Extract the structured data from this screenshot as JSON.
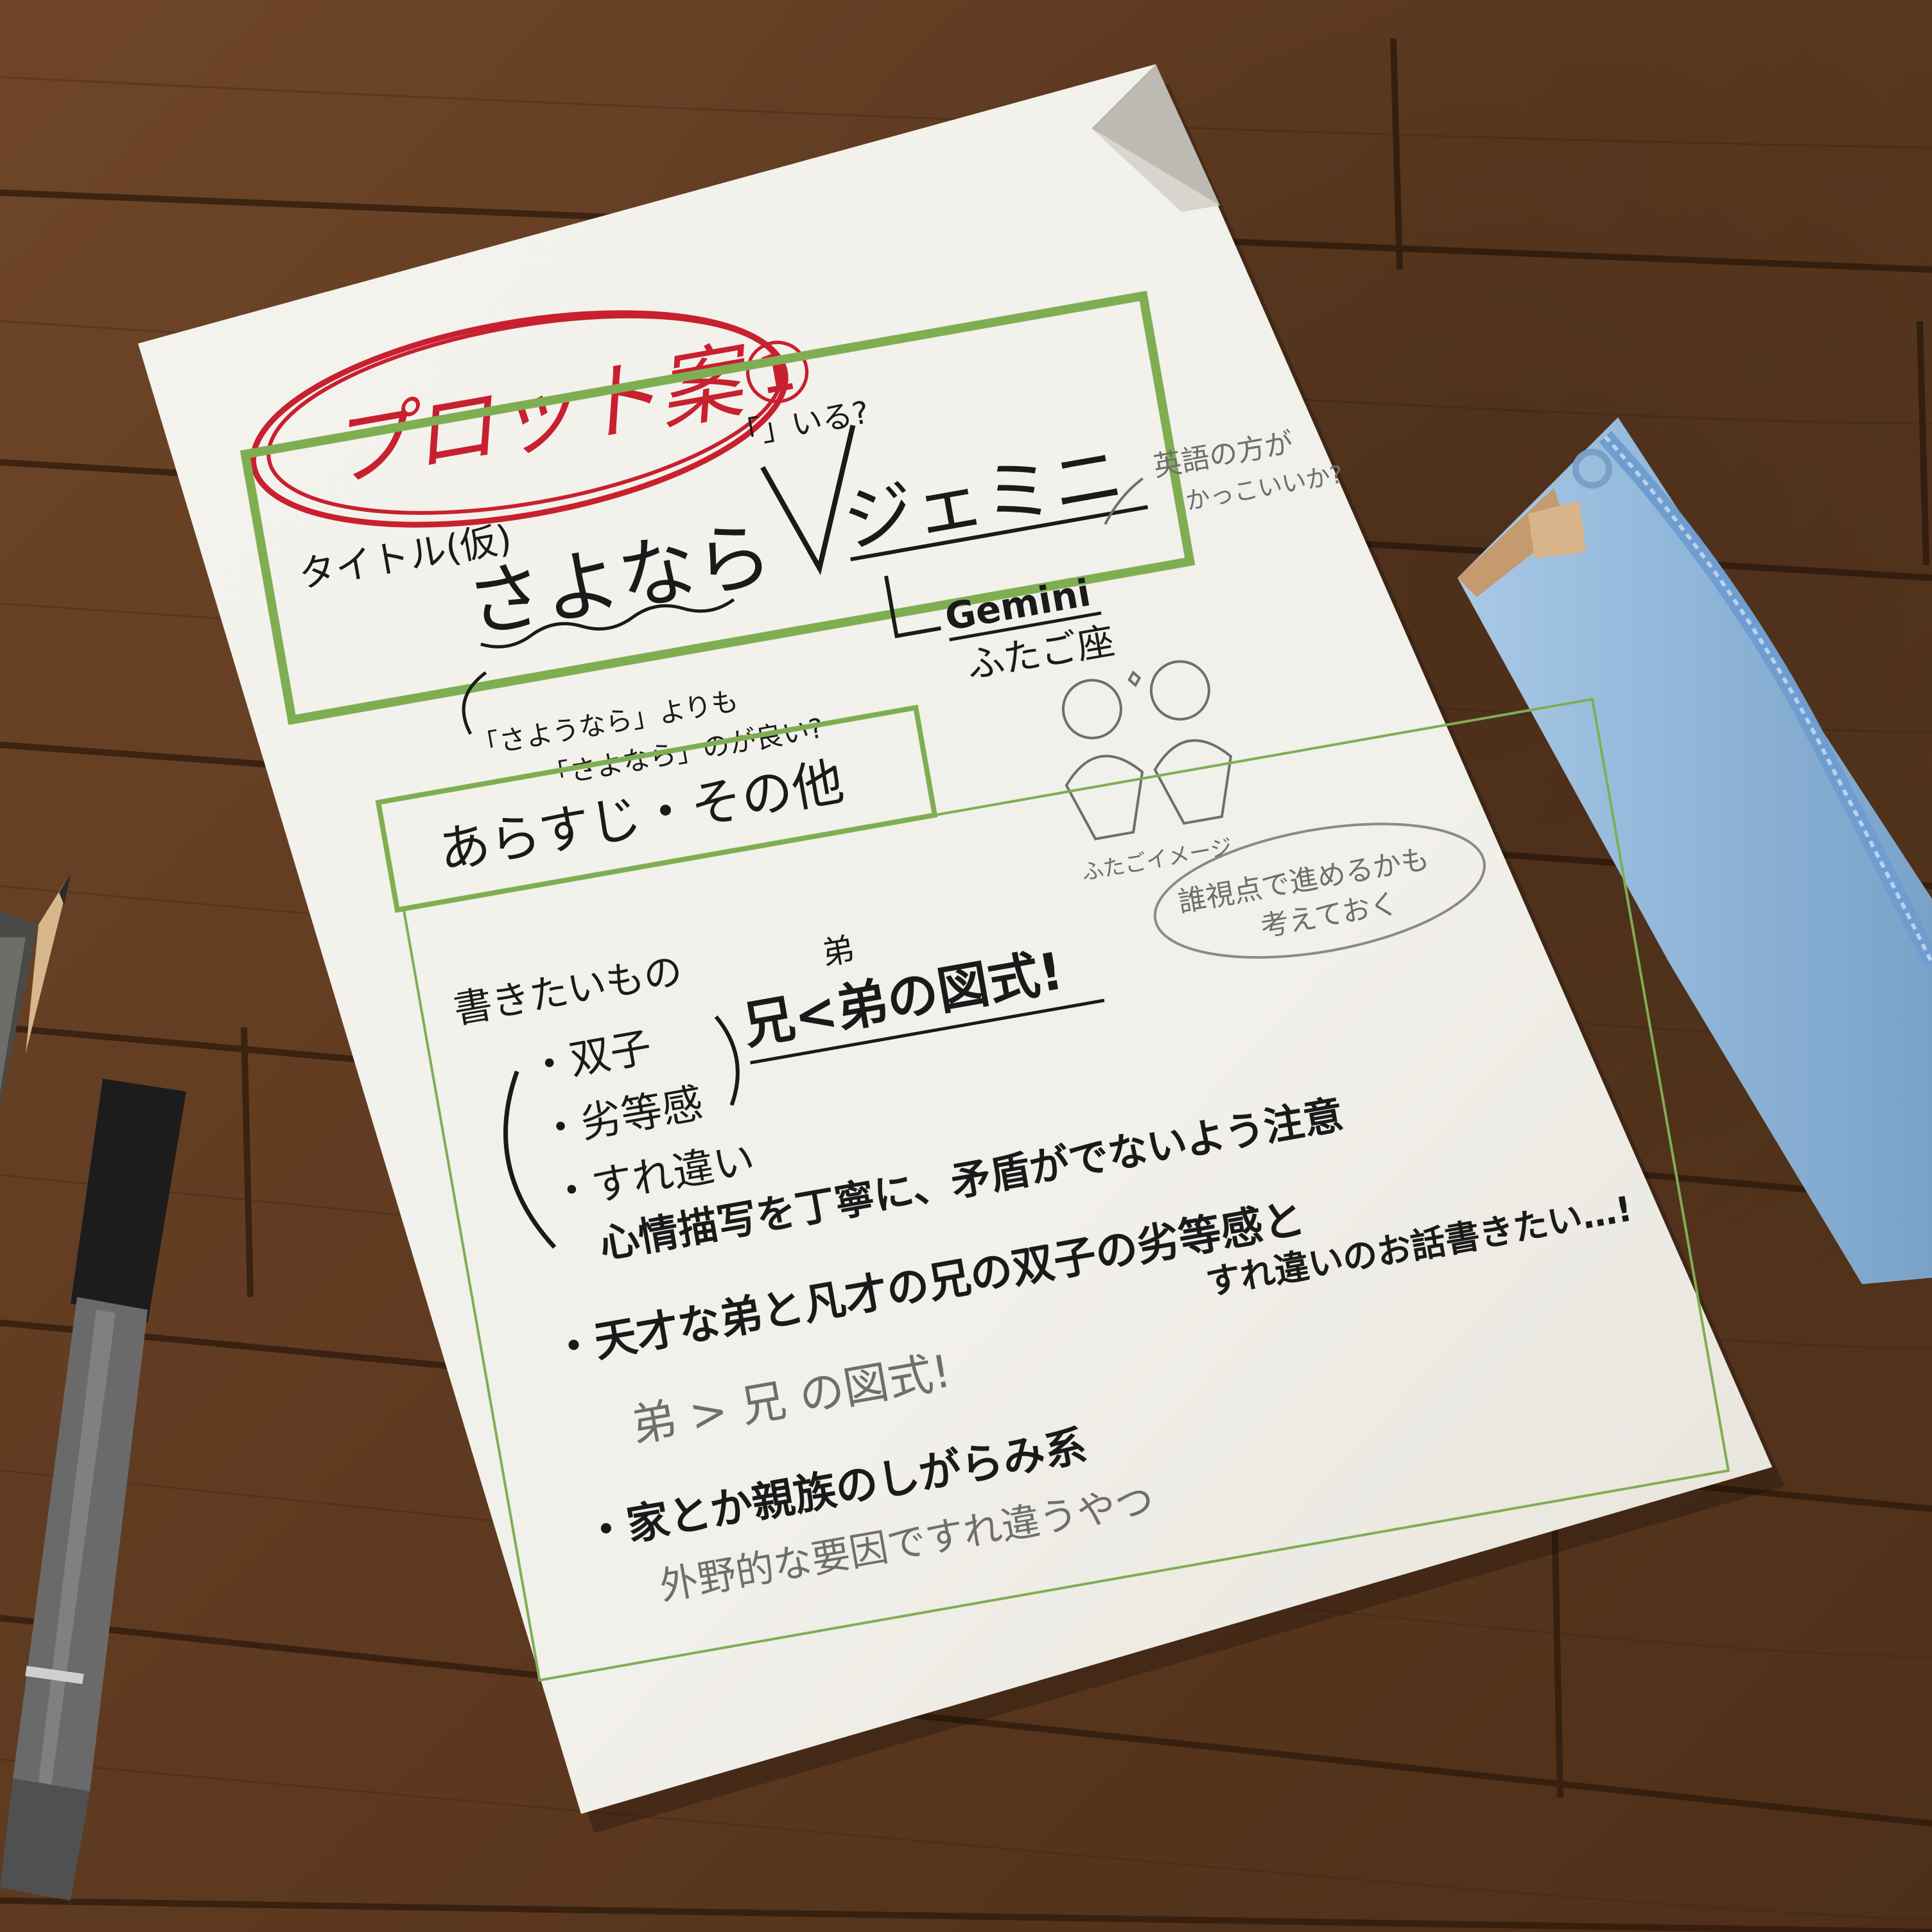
{
  "note": {
    "heading": "プロット案①",
    "title_section": {
      "label": "タイトル(仮)",
      "title_main": "さよなら",
      "title_alt": "ジェミニ",
      "quote_question": "「」いる?",
      "english_note_line1": "英語の方が",
      "english_note_line2": "かっこいいか?",
      "gemini_en": "Gemini",
      "gemini_jp": "ふたご座",
      "sayonara_note_line1": "「さようなら」よりも",
      "sayonara_note_line2": "「さよなら」のが良い?"
    },
    "synopsis_label": "あらすじ・その他",
    "doodle_caption": "ふたごイメージ",
    "viewpoint_note_line1": "誰視点で進めるかも",
    "viewpoint_note_line2": "考えておく",
    "want_to_write": "書きたいもの",
    "items": [
      "・双子",
      "・劣等感",
      "・すれ違い"
    ],
    "brother_diagram": "兄<弟の図式!",
    "brother_diagram_top": "弟",
    "careful_note": "心情描写を丁寧に、矛盾がでないよう注意",
    "story_line1": "・天才な弟と凡才の兄の双子の劣等感と",
    "story_line2": "すれ違いのお話書きたい…!",
    "diagram2": "弟 > 兄 の図式!",
    "family_line": "・家とか親族のしがらみ系",
    "family_sub": "外野的な要因ですれ違うやつ"
  },
  "colors": {
    "wood": "#6a4326",
    "paper": "#f5f3ee",
    "green_box": "#7fae52",
    "red_ink": "#c8202f",
    "pouch": "#9cc0e0"
  }
}
